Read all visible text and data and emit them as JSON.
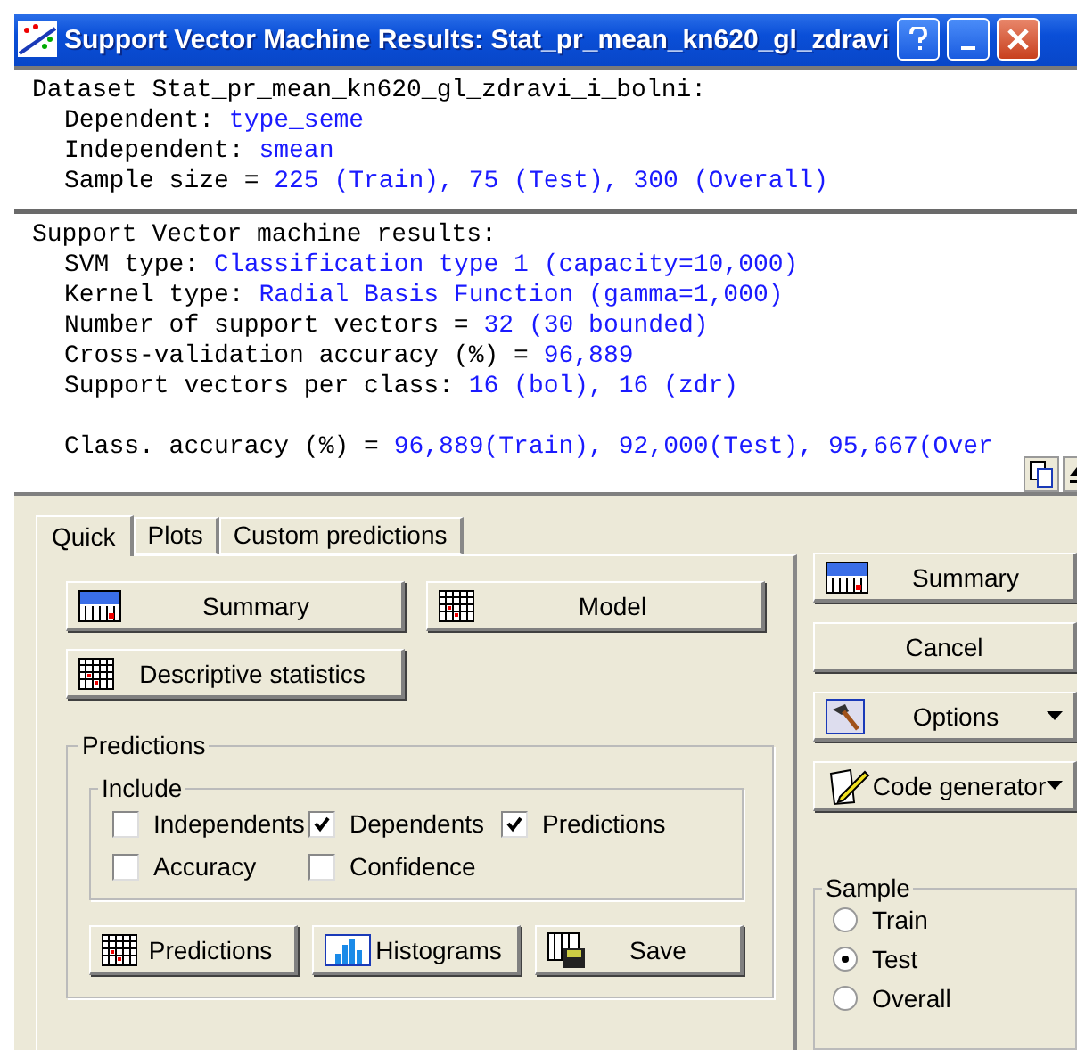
{
  "window": {
    "title": "Support Vector Machine Results: Stat_pr_mean_kn620_gl_zdravi"
  },
  "output_sections": [
    {
      "heading": "Dataset Stat_pr_mean_kn620_gl_zdravi_i_bolni:",
      "entries": [
        {
          "label": "Dependent:",
          "value": "type_seme"
        },
        {
          "label": "Independent:",
          "value": "smean"
        },
        {
          "label": "Sample size =",
          "value": "225 (Train), 75 (Test), 300 (Overall)"
        }
      ]
    },
    {
      "heading": "Support Vector machine results:",
      "entries": [
        {
          "label": "SVM type:",
          "value": "Classification type 1 (capacity=10,000)"
        },
        {
          "label": "Kernel type:",
          "value": "Radial Basis Function (gamma=1,000)"
        },
        {
          "label": "Number of support vectors =",
          "value": "32 (30 bounded)"
        },
        {
          "label": "Cross-validation accuracy (%) =",
          "value": "96,889"
        },
        {
          "label": "Support vectors per class:",
          "value": "16 (bol), 16 (zdr)"
        }
      ],
      "after_gap": [
        {
          "label": "Class. accuracy (%) =",
          "value": "96,889(Train), 92,000(Test), 95,667(Over"
        }
      ]
    }
  ],
  "tabs": [
    {
      "label": "Quick",
      "selected": true
    },
    {
      "label": "Plots",
      "selected": false
    },
    {
      "label": "Custom predictions",
      "selected": false
    }
  ],
  "quick_buttons": [
    {
      "label": "Summary",
      "kind": "summary"
    },
    {
      "label": "Model",
      "kind": "model"
    },
    {
      "label": "Descriptive statistics",
      "kind": "statistics"
    }
  ],
  "predictions": {
    "title": "Predictions",
    "include": {
      "title": "Include",
      "options": [
        {
          "label": "Independents",
          "checked": false
        },
        {
          "label": "Dependents",
          "checked": true
        },
        {
          "label": "Predictions",
          "checked": true
        },
        {
          "label": "Accuracy",
          "checked": false
        },
        {
          "label": "Confidence",
          "checked": false
        }
      ]
    },
    "buttons": [
      {
        "label": "Predictions",
        "kind": "predictions"
      },
      {
        "label": "Histograms",
        "kind": "histograms"
      },
      {
        "label": "Save",
        "kind": "save"
      }
    ]
  },
  "side_buttons": [
    {
      "label": "Summary",
      "kind": "summary",
      "dropdown": false
    },
    {
      "label": "Cancel",
      "kind": "cancel",
      "dropdown": false
    },
    {
      "label": "Options",
      "kind": "options",
      "dropdown": true
    },
    {
      "label": "Code generator",
      "kind": "code",
      "dropdown": true
    }
  ],
  "sample": {
    "title": "Sample",
    "options": [
      {
        "label": "Train",
        "selected": false
      },
      {
        "label": "Test",
        "selected": true
      },
      {
        "label": "Overall",
        "selected": false
      }
    ]
  }
}
